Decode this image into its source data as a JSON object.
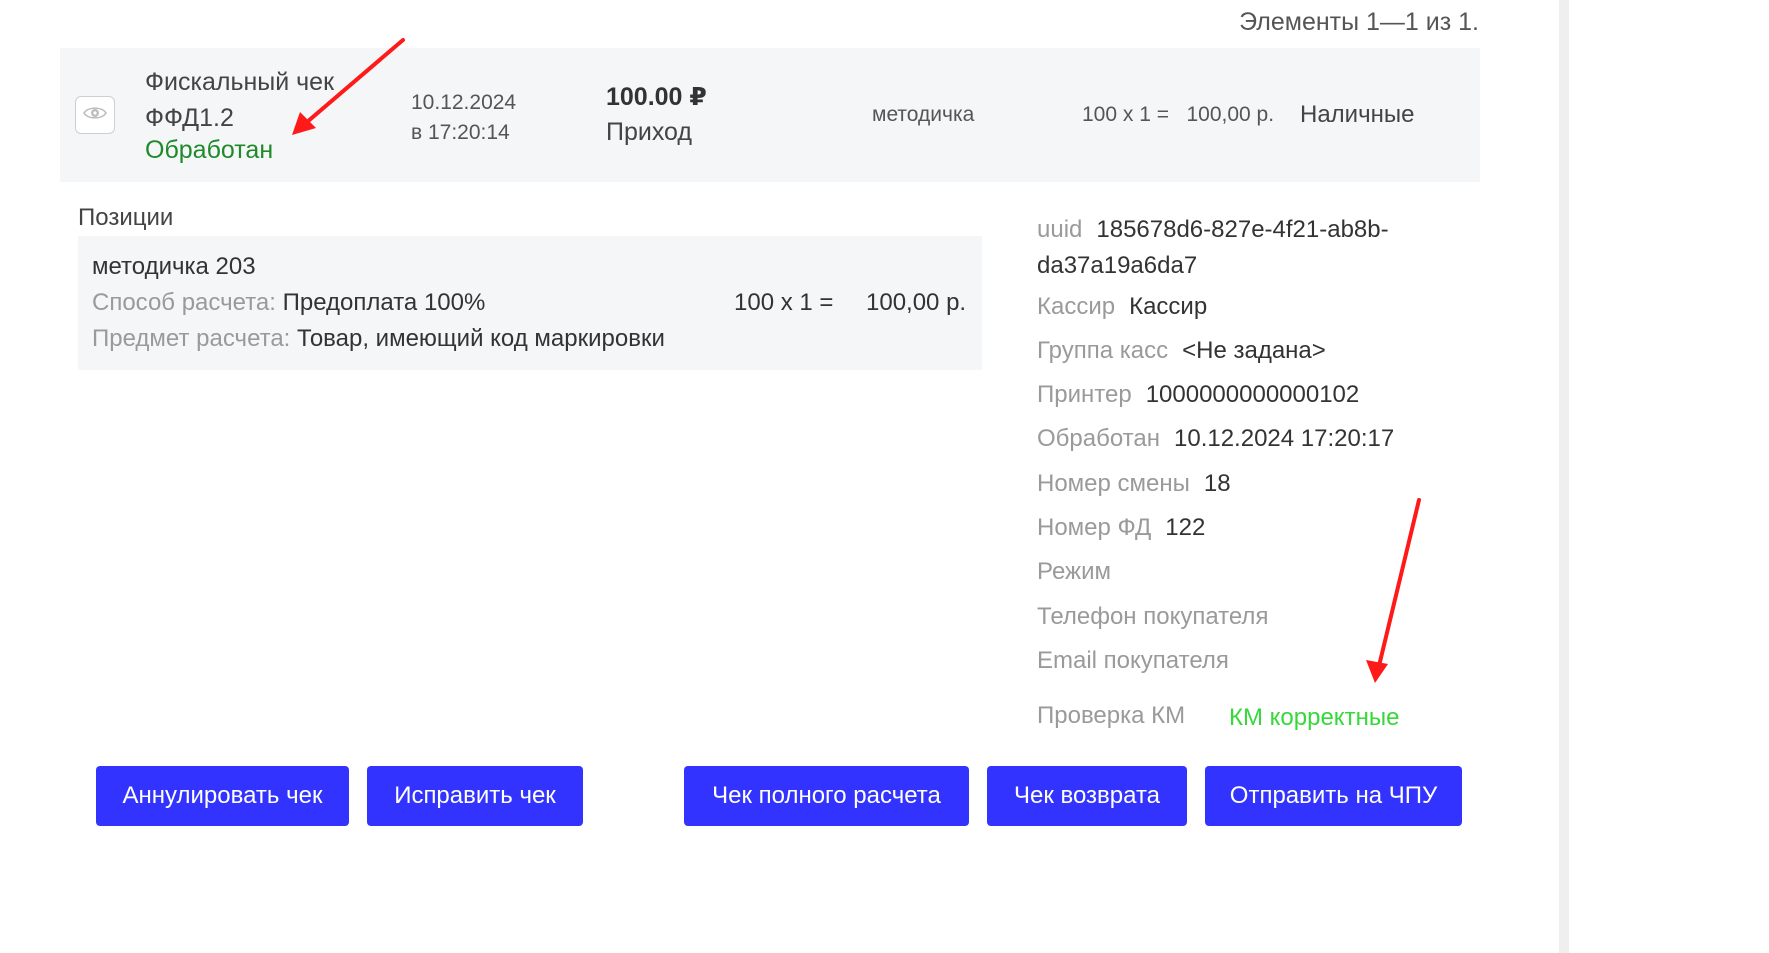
{
  "pager": {
    "text": "Элементы 1—1 из 1."
  },
  "receipt": {
    "title": "Фискальный чек ФФД1.2",
    "status": "Обработан",
    "date": "10.12.2024",
    "time": "в 17:20:14",
    "amount": "100.00 ₽",
    "kind": "Приход",
    "name": "методичка",
    "calc": "100 x 1 =   100,00 р.",
    "payment": "Наличные",
    "view_icon": "eye-icon"
  },
  "positions": {
    "label": "Позиции",
    "items": [
      {
        "name": "методичка 203",
        "method_label": "Способ расчета:",
        "method_value": "Предоплата 100%",
        "subject_label": "Предмет расчета:",
        "subject_value": "Товар, имеющий код маркировки",
        "qty": "100 x 1 =",
        "sum": "100,00 р."
      }
    ]
  },
  "details": {
    "uuid_label": "uuid",
    "uuid_value": "185678d6-827e-4f21-ab8b-da37a19a6da7",
    "cashier_label": "Кассир",
    "cashier_value": "Кассир",
    "group_label": "Группа касс",
    "group_value": "<Не задана>",
    "printer_label": "Принтер",
    "printer_value": "1000000000000102",
    "processed_label": "Обработан",
    "processed_value": "10.12.2024 17:20:17",
    "shift_label": "Номер смены",
    "shift_value": "18",
    "fd_label": "Номер ФД",
    "fd_value": "122",
    "mode_label": "Режим",
    "phone_label": "Телефон покупателя",
    "email_label": "Email покупателя",
    "km_label": "Проверка КМ",
    "km_value": "КМ корректные"
  },
  "buttons": {
    "annul": "Аннулировать чек",
    "fix": "Исправить чек",
    "full": "Чек полного расчета",
    "refund": "Чек возврата",
    "send": "Отправить на ЧПУ"
  },
  "colors": {
    "button_bg": "#3333ff",
    "status_green": "#1f8a2a",
    "km_green": "#36d83a",
    "annotation_arrow": "#ff1a1a"
  }
}
